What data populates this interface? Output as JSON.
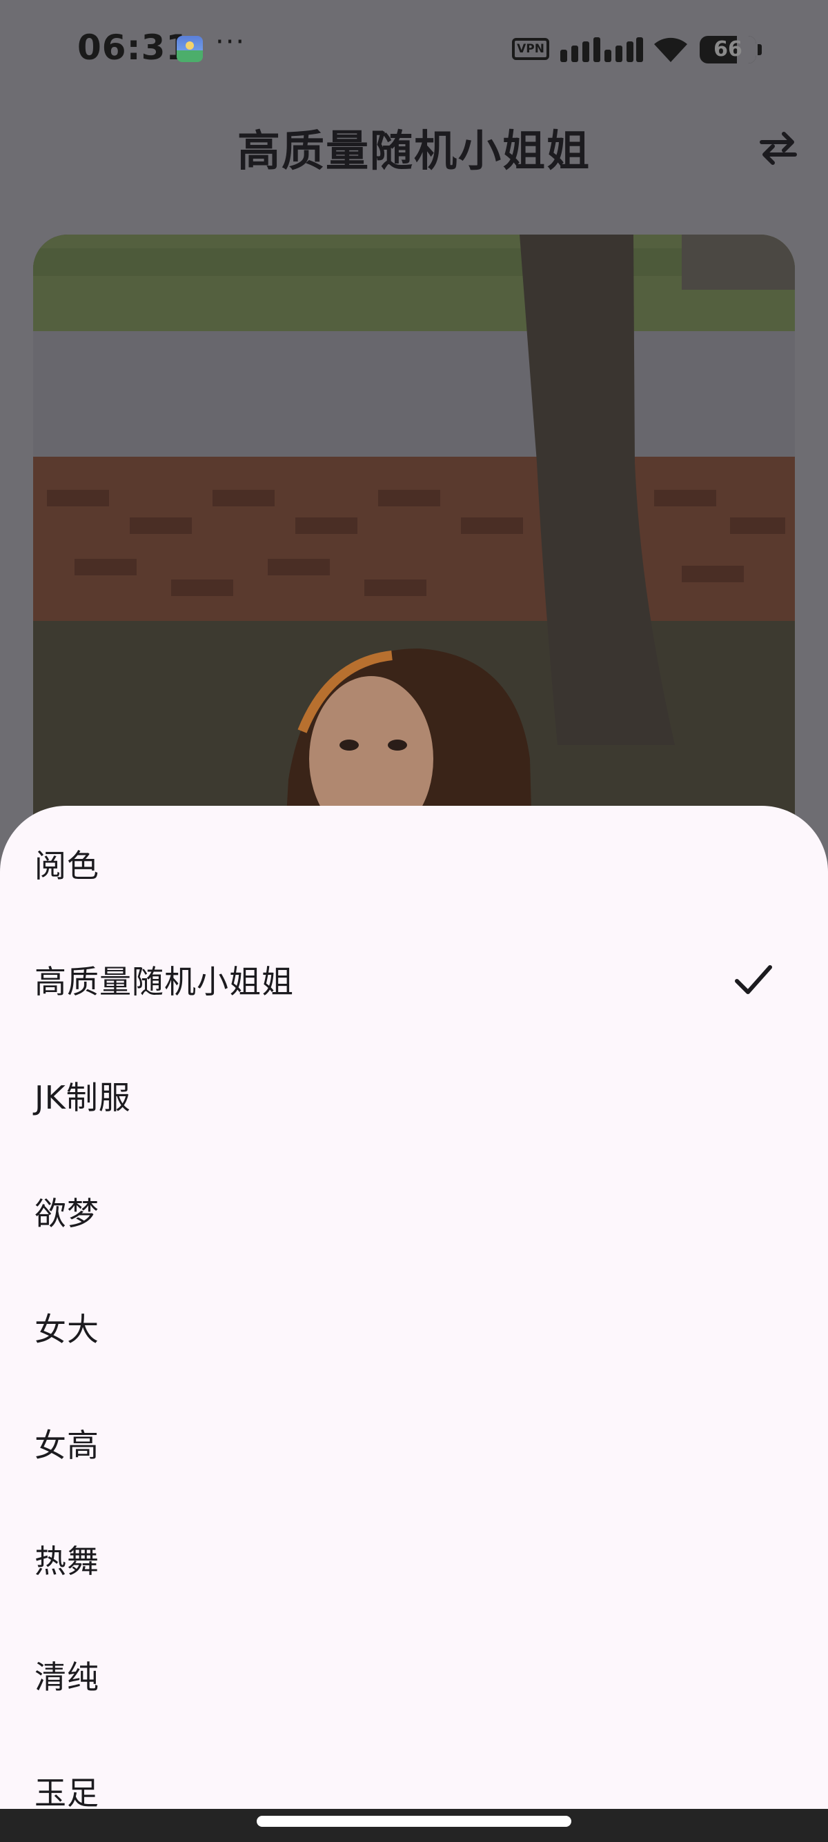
{
  "status_bar": {
    "time": "06:31",
    "more_indicator": "···",
    "vpn_label": "VPN",
    "battery_level": "66",
    "battery_fraction": 0.66,
    "icons": [
      "app-notification-icon",
      "signal-icon",
      "wifi-icon",
      "battery-icon"
    ]
  },
  "app_bar": {
    "title": "高质量随机小姐姐",
    "swap_icon": "swap-horizontal-icon"
  },
  "photo": {
    "description_icon": "photo"
  },
  "sheet": {
    "items": [
      {
        "label": "阅色",
        "selected": false
      },
      {
        "label": "高质量随机小姐姐",
        "selected": true
      },
      {
        "label": "JK制服",
        "selected": false
      },
      {
        "label": "欲梦",
        "selected": false
      },
      {
        "label": "女大",
        "selected": false
      },
      {
        "label": "女高",
        "selected": false
      },
      {
        "label": "热舞",
        "selected": false
      },
      {
        "label": "清纯",
        "selected": false
      },
      {
        "label": "玉足",
        "selected": false
      }
    ],
    "check_icon": "check-icon"
  },
  "colors": {
    "sheet_background": "#fdf7fc",
    "scrim_background": "#6e6d72",
    "text_primary": "#1c1b1f",
    "nav_bar": "#242424"
  }
}
